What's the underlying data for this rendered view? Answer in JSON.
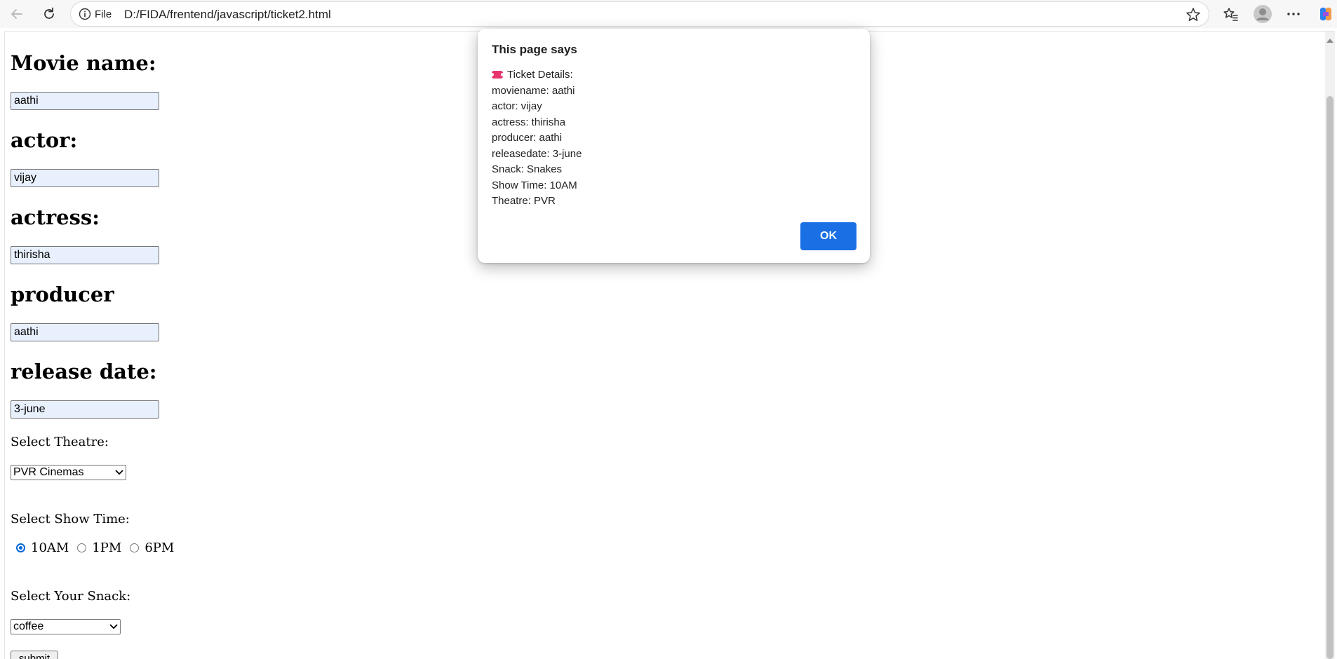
{
  "browser": {
    "url_scheme_label": "File",
    "url": "D:/FIDA/frentend/javascript/ticket2.html"
  },
  "form": {
    "movie_name_label": "Movie name:",
    "movie_name_value": "aathi",
    "actor_label": "actor:",
    "actor_value": "vijay",
    "actress_label": "actress:",
    "actress_value": "thirisha",
    "producer_label": "producer",
    "producer_value": "aathi",
    "release_date_label": "release date:",
    "release_date_value": "3-june",
    "theatre_label": "Select Theatre:",
    "theatre_selected": "PVR Cinemas",
    "showtime_label": "Select Show Time:",
    "showtime_options": [
      "10AM",
      "1PM",
      "6PM"
    ],
    "showtime_selected": "10AM",
    "snack_label": "Select Your Snack:",
    "snack_selected": "coffee",
    "submit_label": "submit"
  },
  "dialog": {
    "title": "This page says",
    "header_line": "Ticket Details:",
    "lines": [
      "moviename: aathi",
      "actor: vijay",
      "actress: thirisha",
      "producer: aathi",
      "releasedate: 3-june",
      "Snack: Snakes",
      "Show Time: 10AM",
      "Theatre: PVR"
    ],
    "ok_label": "OK"
  },
  "colors": {
    "accent": "#1a6fe4",
    "autofill": "#e8f0fe",
    "ticket_icon": "#e8336d"
  }
}
